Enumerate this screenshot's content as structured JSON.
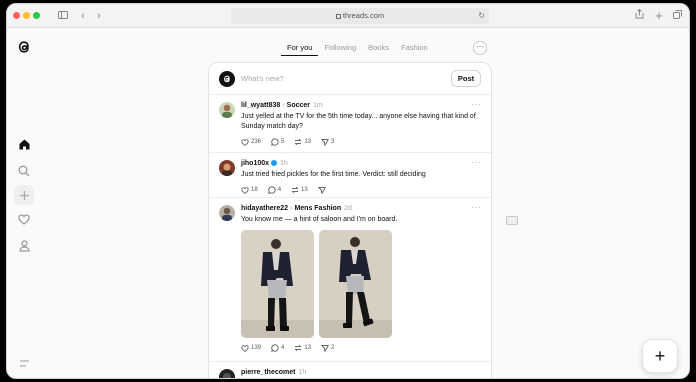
{
  "browser": {
    "url": "threads.com"
  },
  "tabs": [
    {
      "label": "For you",
      "active": true
    },
    {
      "label": "Following",
      "active": false
    },
    {
      "label": "Books",
      "active": false
    },
    {
      "label": "Fashion",
      "active": false
    }
  ],
  "composer": {
    "placeholder": "What's new?",
    "post_label": "Post"
  },
  "posts": [
    {
      "username": "lil_wyatt838",
      "topic": "Soccer",
      "time": "1m",
      "text": "Just yelled at the TV for the 5th time today... anyone else having that kind of Sunday match day?",
      "likes": "236",
      "comments": "5",
      "reposts": "13",
      "shares": "3"
    },
    {
      "username": "jiho100x",
      "time": "1h",
      "text": "Just tried fried pickles for the first time. Verdict: still deciding",
      "likes": "18",
      "comments": "4",
      "reposts": "13",
      "shares": ""
    },
    {
      "username": "hidayathere22",
      "topic": "Mens Fashion",
      "time": "2d",
      "text": "You know me — a hint of saloon and I'm on board.",
      "likes": "139",
      "comments": "4",
      "reposts": "13",
      "shares": "2"
    },
    {
      "username": "pierre_thecomet",
      "time": "1h"
    }
  ],
  "icons": {
    "logo": "threads-logo-icon",
    "home": "home-icon",
    "search": "search-icon",
    "create": "plus-icon",
    "activity": "heart-icon",
    "profile": "person-icon",
    "menu": "menu-icon"
  }
}
